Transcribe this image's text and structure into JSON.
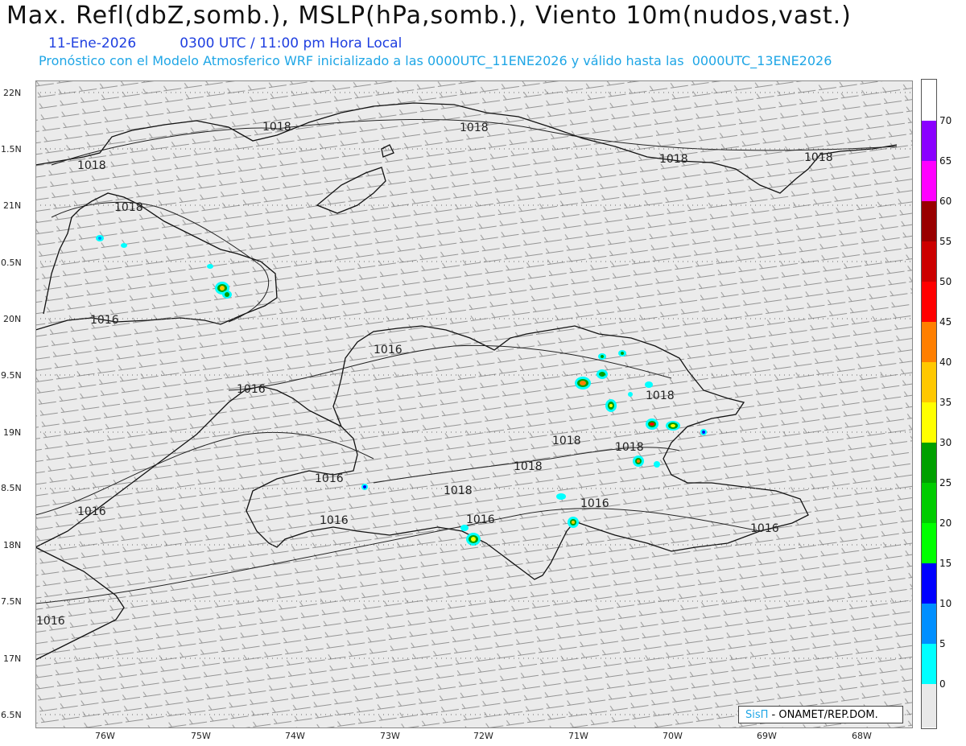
{
  "header": {
    "title": "Max. Refl(dbZ,somb.), MSLP(hPa,somb.), Viento 10m(nudos,vast.)",
    "date_label": "11-Ene-2026",
    "time_label": "0300 UTC / 11:00 pm Hora Local",
    "description": "Pronóstico con el Modelo Atmosferico WRF inicializado a las 0000UTC_11ENE2026 y válido hasta las  0000UTC_13ENE2026"
  },
  "axes": {
    "lat_labels": [
      "22N",
      "1.5N",
      "21N",
      "0.5N",
      "20N",
      "9.5N",
      "19N",
      "8.5N",
      "18N",
      "7.5N",
      "17N",
      "6.5N"
    ],
    "lon_labels": [
      "76W",
      "75W",
      "74W",
      "73W",
      "72W",
      "71W",
      "70W",
      "69W",
      "68W"
    ]
  },
  "isobars": {
    "labels": [
      "1018",
      "1018",
      "1018",
      "1018",
      "1018",
      "1018",
      "1016",
      "1016",
      "1018",
      "1018",
      "1018",
      "1018",
      "1016",
      "1016",
      "1016",
      "1016",
      "1016",
      "1018",
      "1016",
      "1016",
      "1016"
    ]
  },
  "colorbar": {
    "labels": [
      "70",
      "65",
      "60",
      "55",
      "50",
      "45",
      "40",
      "35",
      "30",
      "25",
      "20",
      "15",
      "10",
      "5",
      "0"
    ],
    "colors": [
      "#8a00ff",
      "#ff00ff",
      "#990000",
      "#cc0000",
      "#ff0000",
      "#ff7f00",
      "#ffc800",
      "#ffff00",
      "#00a000",
      "#00cc00",
      "#00ff00",
      "#0000ff",
      "#008fff",
      "#00ffff",
      "#e8e8e8"
    ]
  },
  "credit": {
    "logo": "SisΠ",
    "text": " - ONAMET/REP.DOM."
  }
}
